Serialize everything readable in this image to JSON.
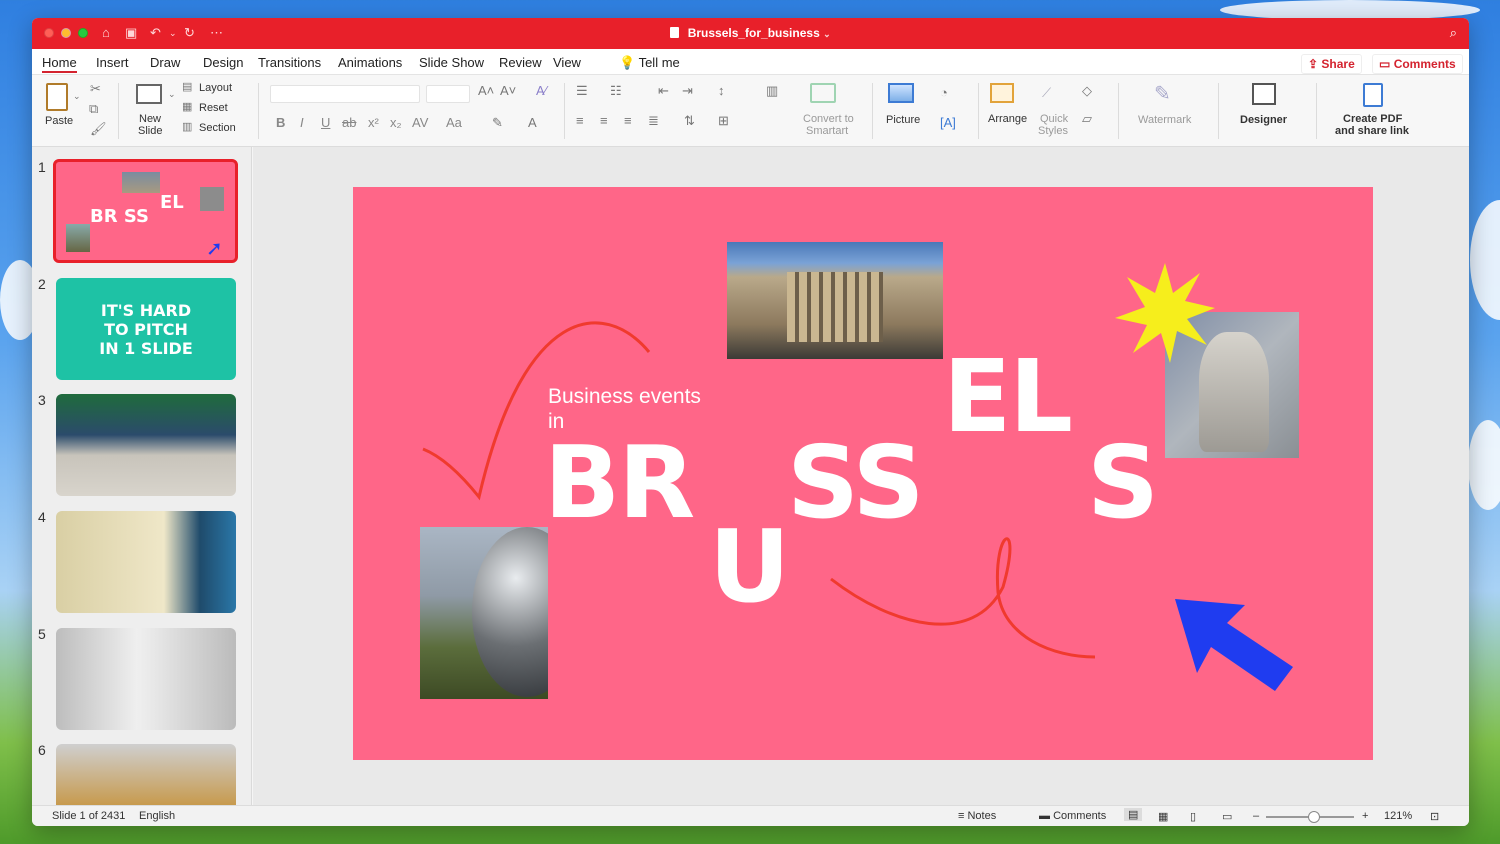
{
  "window": {
    "title": "Brussels_for_business"
  },
  "menu_tabs": [
    "Home",
    "Insert",
    "Draw",
    "Design",
    "Transitions",
    "Animations",
    "Slide Show",
    "Review",
    "View"
  ],
  "tell_me": "Tell me",
  "share_label": "Share",
  "comments_label": "Comments",
  "ribbon": {
    "paste": "Paste",
    "new_slide_1": "New",
    "new_slide_2": "Slide",
    "layout": "Layout",
    "reset": "Reset",
    "section": "Section",
    "convert_1": "Convert to",
    "convert_2": "Smartart",
    "picture": "Picture",
    "arrange": "Arrange",
    "quick_1": "Quick",
    "quick_2": "Styles",
    "watermark": "Watermark",
    "designer": "Designer",
    "create_pdf_1": "Create PDF",
    "create_pdf_2": "and share link",
    "font_format": [
      "B",
      "I",
      "U",
      "ab",
      "x²",
      "x₂",
      "AV",
      "Aa"
    ]
  },
  "slides": [
    {
      "num": "1",
      "text": ""
    },
    {
      "num": "2",
      "text": "IT'S HARD TO PITCH IN 1 SLIDE"
    },
    {
      "num": "3",
      "text": ""
    },
    {
      "num": "4",
      "text": ""
    },
    {
      "num": "5",
      "text": ""
    },
    {
      "num": "6",
      "text": ""
    }
  ],
  "slide_content": {
    "subtitle_1": "Business events",
    "subtitle_2": "in",
    "letters_br": "BR",
    "letters_u": "U",
    "letters_ss": "SS",
    "letters_el": "EL",
    "letters_s": "S"
  },
  "status": {
    "slide_info": "Slide 1 of 2431",
    "language": "English",
    "notes": "Notes",
    "comments": "Comments",
    "zoom": "121%"
  },
  "colors": {
    "accent": "#e8202a",
    "slide_bg": "#ff6688",
    "teal": "#1ec2a5",
    "arrow_blue": "#1f3cf0",
    "star_yellow": "#f6ee1c"
  }
}
